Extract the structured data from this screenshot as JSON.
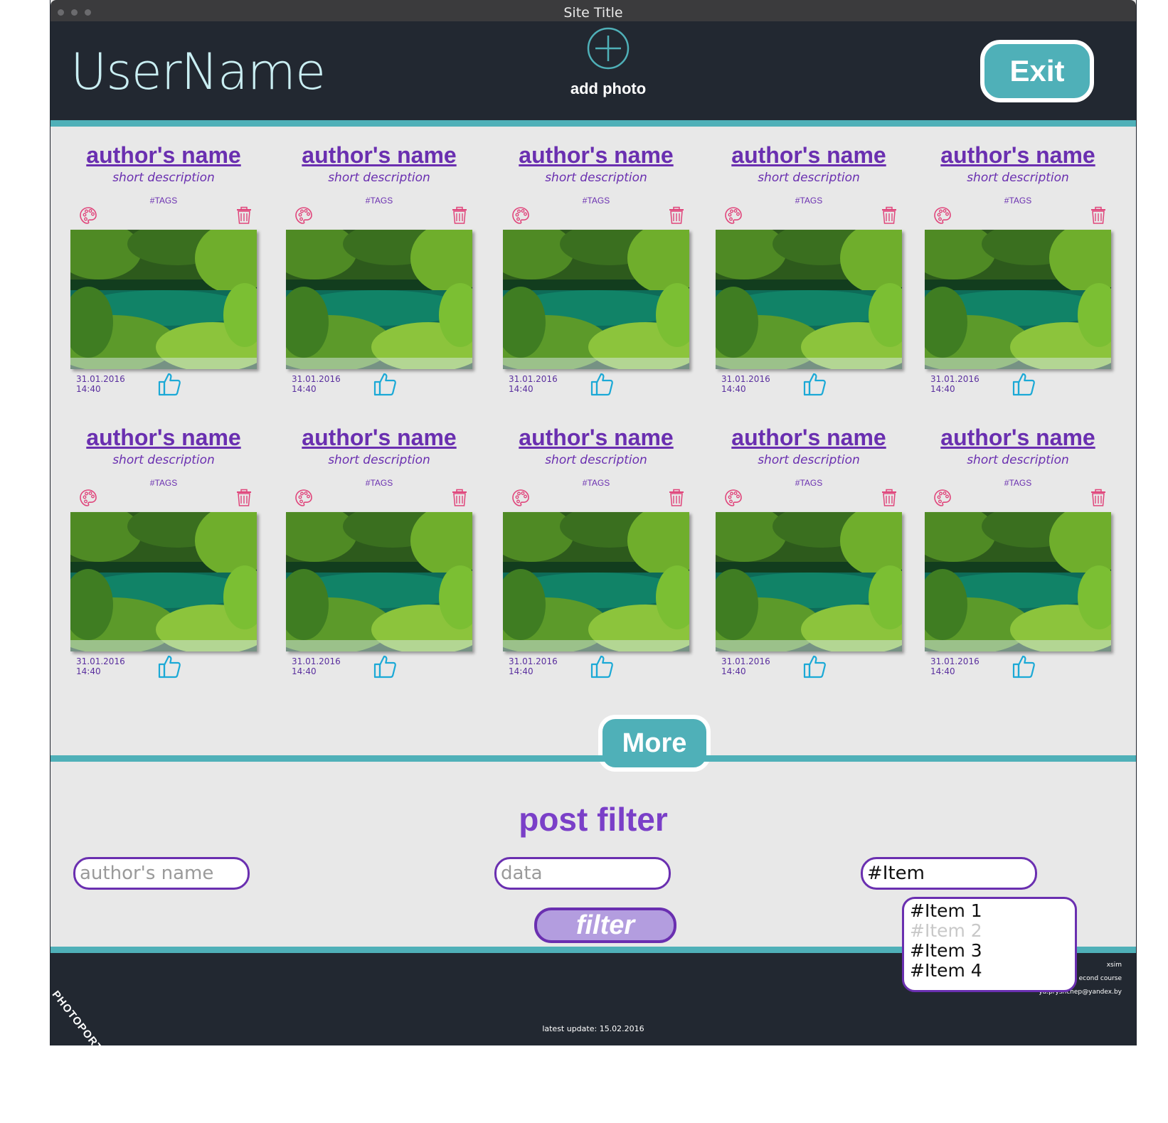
{
  "window": {
    "title": "Site Title"
  },
  "header": {
    "username": "UserName",
    "add_photo_label": "add photo",
    "exit_label": "Exit"
  },
  "colors": {
    "header_bg": "#222831",
    "accent_teal": "#4fb0b8",
    "purple": "#6a2fb0",
    "pink_icon": "#e0457b",
    "like_blue": "#1ba9d6",
    "content_bg": "#e8e8e8"
  },
  "posts": [
    {
      "author": "author's name",
      "description": "short description",
      "tags": "#TAGS",
      "date": "31.01.2016",
      "time": "14:40",
      "icons": [
        "palette-icon",
        "trash-icon",
        "thumbs-up-icon"
      ]
    },
    {
      "author": "author's name",
      "description": "short description",
      "tags": "#TAGS",
      "date": "31.01.2016",
      "time": "14:40",
      "icons": [
        "palette-icon",
        "trash-icon",
        "thumbs-up-icon"
      ]
    },
    {
      "author": "author's name",
      "description": "short description",
      "tags": "#TAGS",
      "date": "31.01.2016",
      "time": "14:40",
      "icons": [
        "palette-icon",
        "trash-icon",
        "thumbs-up-icon"
      ]
    },
    {
      "author": "author's name",
      "description": "short description",
      "tags": "#TAGS",
      "date": "31.01.2016",
      "time": "14:40",
      "icons": [
        "palette-icon",
        "trash-icon",
        "thumbs-up-icon"
      ]
    },
    {
      "author": "author's name",
      "description": "short description",
      "tags": "#TAGS",
      "date": "31.01.2016",
      "time": "14:40",
      "icons": [
        "palette-icon",
        "trash-icon",
        "thumbs-up-icon"
      ]
    },
    {
      "author": "author's name",
      "description": "short description",
      "tags": "#TAGS",
      "date": "31.01.2016",
      "time": "14:40",
      "icons": [
        "palette-icon",
        "trash-icon",
        "thumbs-up-icon"
      ]
    },
    {
      "author": "author's name",
      "description": "short description",
      "tags": "#TAGS",
      "date": "31.01.2016",
      "time": "14:40",
      "icons": [
        "palette-icon",
        "trash-icon",
        "thumbs-up-icon"
      ]
    },
    {
      "author": "author's name",
      "description": "short description",
      "tags": "#TAGS",
      "date": "31.01.2016",
      "time": "14:40",
      "icons": [
        "palette-icon",
        "trash-icon",
        "thumbs-up-icon"
      ]
    },
    {
      "author": "author's name",
      "description": "short description",
      "tags": "#TAGS",
      "date": "31.01.2016",
      "time": "14:40",
      "icons": [
        "palette-icon",
        "trash-icon",
        "thumbs-up-icon"
      ]
    },
    {
      "author": "author's name",
      "description": "short description",
      "tags": "#TAGS",
      "date": "31.01.2016",
      "time": "14:40",
      "icons": [
        "palette-icon",
        "trash-icon",
        "thumbs-up-icon"
      ]
    }
  ],
  "more_label": "More",
  "filter": {
    "title": "post filter",
    "author_placeholder": "author's name",
    "data_placeholder": "data",
    "tag_value": "#Item",
    "button_label": "filter",
    "options": [
      {
        "label": "#Item 1",
        "disabled": false
      },
      {
        "label": "#Item 2",
        "disabled": true
      },
      {
        "label": "#Item 3",
        "disabled": false
      },
      {
        "label": "#Item 4",
        "disabled": false
      }
    ]
  },
  "footer": {
    "brand": "PHOTOPORTAL",
    "latest_update": "latest update: 15.02.2016",
    "contact_lines": [
      "xsim",
      "econd course",
      "ya.prysnchep@yandex.by"
    ]
  }
}
